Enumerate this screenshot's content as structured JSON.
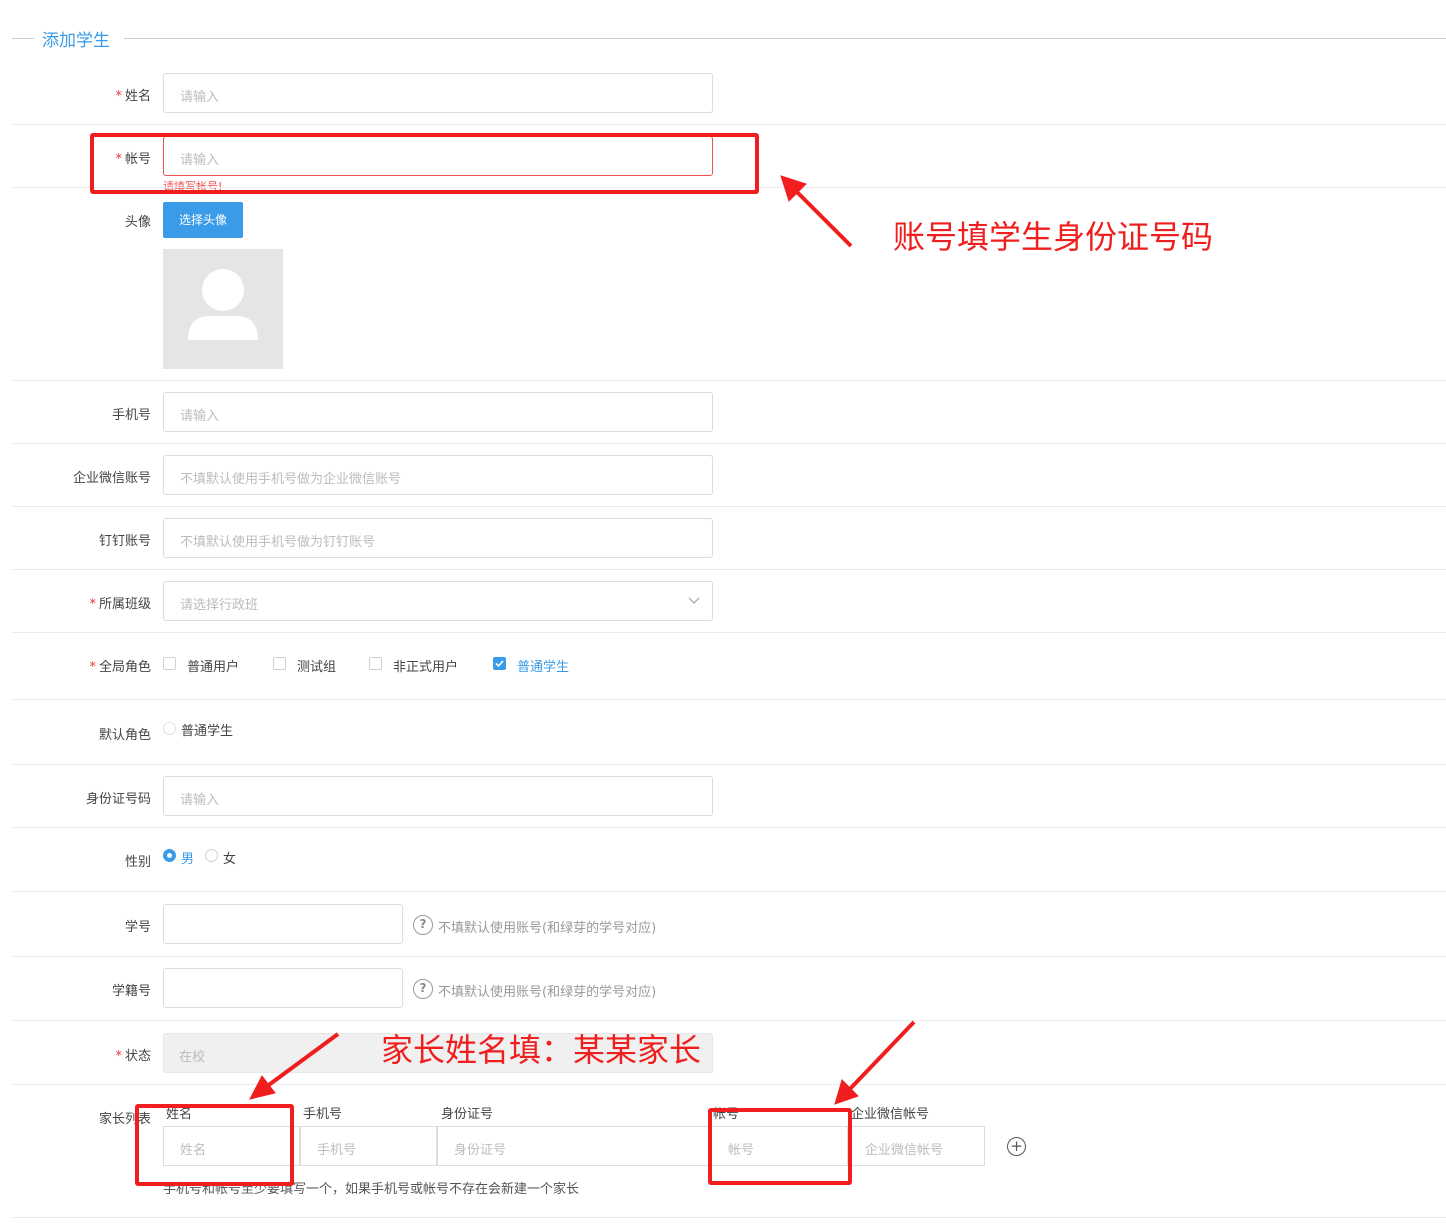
{
  "section_title": "添加学生",
  "fields": {
    "name": {
      "label": "姓名",
      "placeholder": "请输入"
    },
    "account": {
      "label": "帐号",
      "placeholder": "请输入",
      "error": "请填写帐号!"
    },
    "avatar": {
      "label": "头像",
      "button": "选择头像"
    },
    "phone": {
      "label": "手机号",
      "placeholder": "请输入"
    },
    "wecom": {
      "label": "企业微信账号",
      "placeholder": "不填默认使用手机号做为企业微信账号"
    },
    "dingtalk": {
      "label": "钉钉账号",
      "placeholder": "不填默认使用手机号做为钉钉账号"
    },
    "class": {
      "label": "所属班级",
      "placeholder": "请选择行政班"
    },
    "global_role": {
      "label": "全局角色",
      "options": [
        {
          "label": "普通用户",
          "checked": false
        },
        {
          "label": "测试组",
          "checked": false
        },
        {
          "label": "非正式用户",
          "checked": false
        },
        {
          "label": "普通学生",
          "checked": true
        }
      ]
    },
    "default_role": {
      "label": "默认角色",
      "option": "普通学生"
    },
    "id_card": {
      "label": "身份证号码",
      "placeholder": "请输入"
    },
    "gender": {
      "label": "性别",
      "options": [
        {
          "label": "男",
          "checked": true
        },
        {
          "label": "女",
          "checked": false
        }
      ]
    },
    "student_no": {
      "label": "学号",
      "help": "不填默认使用账号(和绿芽的学号对应)"
    },
    "registry_no": {
      "label": "学籍号",
      "help": "不填默认使用账号(和绿芽的学号对应)"
    },
    "status": {
      "label": "状态",
      "value": "在校"
    },
    "parents": {
      "label": "家长列表",
      "columns": [
        "姓名",
        "手机号",
        "身份证号",
        "帐号",
        "企业微信帐号"
      ],
      "placeholders": [
        "姓名",
        "手机号",
        "身份证号",
        "帐号",
        "企业微信帐号"
      ],
      "add": "+",
      "hint": "手机号和帐号至少要填写一个，如果手机号或帐号不存在会新建一个家长"
    }
  },
  "annotations": {
    "account_note": "账号填学生身份证号码",
    "parent_note": "家长姓名填：某某家长"
  },
  "colors": {
    "accent": "#3a9be8",
    "error": "#f05050",
    "annotation": "#f01e1e"
  }
}
